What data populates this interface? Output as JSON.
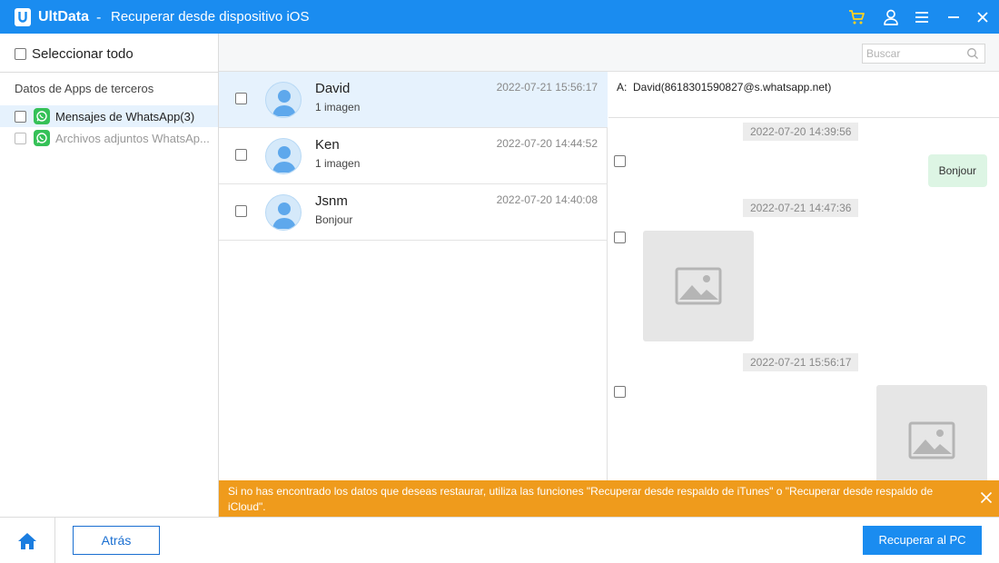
{
  "titlebar": {
    "app_name": "UltData",
    "separator": "-",
    "subtitle": "Recuperar desde dispositivo iOS",
    "icons": [
      "logo-icon",
      "cart-icon",
      "user-icon",
      "menu-icon",
      "minimize-icon",
      "close-icon"
    ]
  },
  "sidebar": {
    "select_all": "Seleccionar todo",
    "category_title": "Datos de Apps de terceros",
    "items": [
      {
        "label": "Mensajes de WhatsApp(3)",
        "icon": "whatsapp-icon",
        "active": true
      },
      {
        "label": "Archivos adjuntos WhatsAp...",
        "icon": "whatsapp-icon",
        "active": false
      }
    ]
  },
  "search": {
    "placeholder": "Buscar"
  },
  "contacts": [
    {
      "name": "David",
      "preview": "1 imagen",
      "time": "2022-07-21 15:56:17",
      "selected": true
    },
    {
      "name": "Ken",
      "preview": "1 imagen",
      "time": "2022-07-20 14:44:52",
      "selected": false
    },
    {
      "name": "Jsnm",
      "preview": "Bonjour",
      "time": "2022-07-20 14:40:08",
      "selected": false
    }
  ],
  "chat": {
    "to_label": "A:",
    "to_value": "David(8618301590827@s.whatsapp.net)",
    "messages": [
      {
        "timestamp": "2022-07-20 14:39:56",
        "type": "text",
        "text": "Bonjour"
      },
      {
        "timestamp": "2022-07-21 14:47:36",
        "type": "image"
      },
      {
        "timestamp": "2022-07-21 15:56:17",
        "type": "image"
      }
    ]
  },
  "notice": {
    "text": "Si no has encontrado los datos que deseas restaurar, utiliza las funciones \"Recuperar desde respaldo de iTunes\" o \"Recuperar desde respaldo de iCloud\"."
  },
  "footer": {
    "back_label": "Atrás",
    "recover_label": "Recuperar al PC"
  },
  "colors": {
    "accent": "#1a8cf0",
    "notice": "#ef9b1c",
    "whatsapp": "#35c157",
    "selected_row": "#e6f2fd",
    "bubble": "#ddf5e4"
  }
}
